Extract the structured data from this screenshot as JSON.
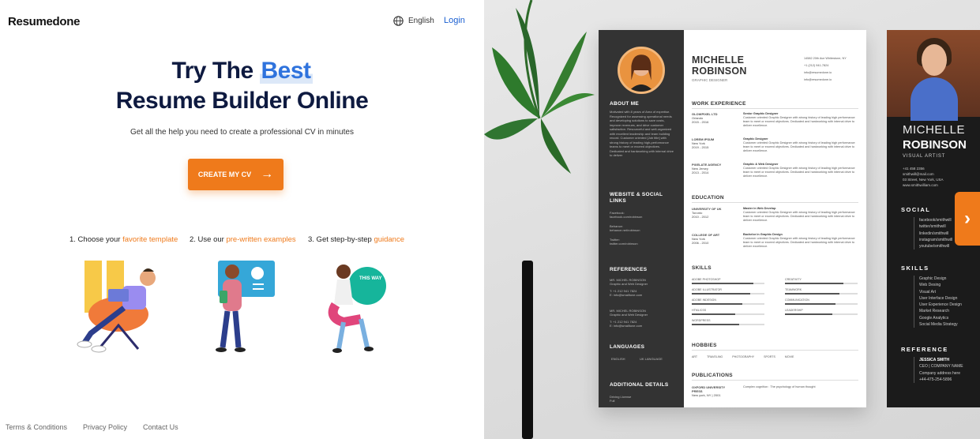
{
  "header": {
    "logo": "Resumedone",
    "language": "English",
    "login": "Login"
  },
  "hero": {
    "title_prefix": "Try The ",
    "title_highlight": "Best",
    "title_line2": "Resume Builder Online",
    "subtitle": "Get all the help you need to create a professional CV in minutes",
    "cta_label": "CREATE MY CV",
    "cta_arrow": "→"
  },
  "steps": [
    {
      "prefix": "1. Choose your ",
      "highlight": "favorite template"
    },
    {
      "prefix": "2. Use our ",
      "highlight": "pre-written examples"
    },
    {
      "prefix": "3. Get step-by-step ",
      "highlight": "guidance"
    }
  ],
  "illustration3_sign": "THIS WAY",
  "footer": {
    "links": [
      "Terms & Conditions",
      "Privacy Policy",
      "Contact Us"
    ]
  },
  "resume1": {
    "first_name": "MICHELLE",
    "last_name": "ROBINSON",
    "role": "GRAPHIC DESIGNER",
    "contact": [
      "14582 20th Ave Whitestone, NY",
      "+1 (212) 941-7824",
      "info@resumedone.io",
      "info@resumedone.io"
    ],
    "sidebar": {
      "about_head": "ABOUT ME",
      "about_text": "Motivated  with 8 years of Area of expertise. Recognized for assessing operational needs and developing solutions to save costs, improve revenues, and drive customer satisfaction. Resourceful and well-organized with excellent leadership and team building record. Customer oriented [Job title] with strong history of leading high-performance teams to meet or exceed objectives. Dedicated and hardworking with internal drive to deliver",
      "web_head": "WEBSITE & SOCIAL LINKS",
      "web_text": [
        "Facebook:",
        "facebook.com/robinson",
        "Behance:",
        "behance.net/robinson",
        "Twitter:",
        "twitter.com/robinson"
      ],
      "ref_head": "REFERENCES",
      "refs": [
        "MR. MICHEL ROBINSON",
        "Graphic and Web Designer",
        "T: +1 212 941 7824",
        "E: info@smalltone.com",
        "MR. MICHEL ROBINSON",
        "Graphic and Web Designer",
        "T: +1 212 941 7824",
        "E: info@smalltone.com"
      ],
      "lang_head": "LANGUAGES",
      "langs": [
        "ENGLISH",
        "UK LANGUAGE"
      ],
      "add_head": "ADDITIONAL DETAILS",
      "add_text": "Driving License",
      "add_text2": "Full"
    },
    "work_head": "WORK EXPERIENCE",
    "jobs": [
      {
        "company": "GLOWPIXEL LTD",
        "place": "Orlando",
        "dates": "2015 - 2016",
        "title": "Senior Graphic Designer",
        "desc": "Customer oriented Graphic Designer with strong history of leading high performance team to meet or exceed objectives. Dedicated and hardworking with internal drive to deliver excellence."
      },
      {
        "company": "LOREM IPSUM",
        "place": "New York",
        "dates": "2019 - 2015",
        "title": "Graphic Designer",
        "desc": "Customer oriented Graphic Designer with strong history of leading high performance team to meet or exceed objectives. Dedicated and hardworking with internal drive to deliver excellence."
      },
      {
        "company": "PIXELATE AGENCY",
        "place": "New Jersey",
        "dates": "2013 - 2014",
        "title": "Graphic & Web Designer",
        "desc": "Customer oriented Graphic Designer with strong history of leading high performance team to meet or exceed objectives. Dedicated and hardworking with internal drive to deliver excellence."
      }
    ],
    "edu_head": "EDUCATION",
    "edu": [
      {
        "school": "UNIVERSITY OF UK",
        "place": "Toronto",
        "dates": "2010 - 2012",
        "title": "Master in Web Develop",
        "desc": "Customer oriented Graphic Designer with strong history of leading high performance team to meet or exceed objectives. Dedicated and hardworking with internal drive to deliver excellence."
      },
      {
        "school": "COLLEGE OF ART",
        "place": "New York",
        "dates": "2006 - 2010",
        "title": "Bachelor in Graphic Design",
        "desc": "Customer oriented Graphic Designer with strong history of leading high performance team to meet or exceed objectives. Dedicated and hardworking with internal drive to deliver excellence."
      }
    ],
    "skills_head": "SKILLS",
    "skills_left": [
      {
        "name": "ADOBE PHOTOSHOP",
        "level": 0.85
      },
      {
        "name": "ADOBE ILLUSTRATOR",
        "level": 0.8
      },
      {
        "name": "ADOBE INDESIGN",
        "level": 0.7
      },
      {
        "name": "HTML/CSS",
        "level": 0.6
      },
      {
        "name": "WORDPRESS",
        "level": 0.65
      }
    ],
    "skills_right": [
      {
        "name": "CREATIVITY",
        "level": 0.8
      },
      {
        "name": "TEAMWORK",
        "level": 0.75
      },
      {
        "name": "COMMUNICATION",
        "level": 0.7
      },
      {
        "name": "LEADERSHIP",
        "level": 0.65
      }
    ],
    "hobbies_head": "HOBBIES",
    "hobbies": [
      "ART",
      "TRAVELING",
      "PHOTOGRAPHY",
      "SPORTS",
      "MOVIE"
    ],
    "pub_head": "PUBLICATIONS",
    "pub_source": "OXFORD UNIVERSITY PRESS",
    "pub_meta": "New york, NY | 2001",
    "pub_title": "Complex cognition : The psychology of human thought"
  },
  "resume2": {
    "first_name": "MICHELLE",
    "last_name": "ROBINSON",
    "role": "VISUAL ARTIST",
    "contact": [
      "+41 458 2356",
      "smithwill@mail.com",
      "03 Street, New York, USA",
      "www.smithwilliam.com"
    ],
    "social_head": "SOCIAL",
    "social": [
      "facebook/smithwill",
      "twitter/smithwill",
      "linkedin/smithwill",
      "instagram/smithwill",
      "youtube/smithwill"
    ],
    "skills_head": "SKILLS",
    "skills": [
      "Graphic Design",
      "Web Desing",
      "Visual Art",
      "User Interface Design",
      "User Experience Design",
      "Market Research",
      "Google Analytics",
      "Social Media Strategy"
    ],
    "ref_head": "REFERENCE",
    "ref": [
      "JESSICA SMITH",
      "CEO | COMPANY NAME",
      "Company address here",
      "+44-475-254-5896"
    ]
  },
  "carousel": {
    "next_label": "›"
  },
  "colors": {
    "accent": "#ef7a1b",
    "link": "#1a5fd1",
    "highlight": "#2f73dd"
  }
}
